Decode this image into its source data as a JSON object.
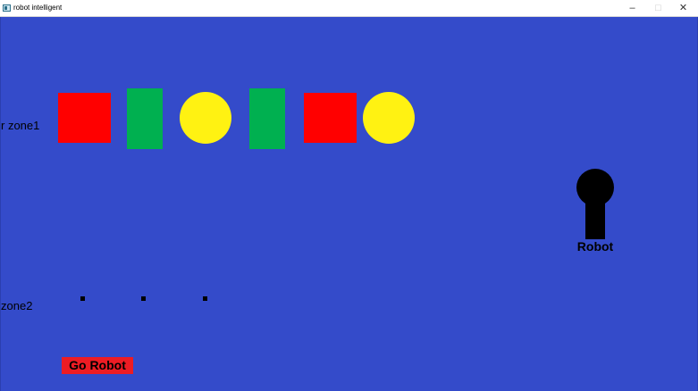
{
  "window": {
    "title": "robot intelligent",
    "minimize": "–",
    "maximize": "□",
    "close": "✕"
  },
  "scene": {
    "background_color": "#344bca",
    "zone1_label": "r zone1",
    "zone2_label": "zone2",
    "zone1_shapes": [
      {
        "shape": "square",
        "color": "#ff0000"
      },
      {
        "shape": "rectangle",
        "color": "#00b050"
      },
      {
        "shape": "circle",
        "color": "#fff212"
      },
      {
        "shape": "rectangle",
        "color": "#00b050"
      },
      {
        "shape": "square",
        "color": "#ff0000"
      },
      {
        "shape": "circle",
        "color": "#fff212"
      }
    ],
    "zone2_slots": 3,
    "robot_label": "Robot",
    "go_button_label": "Go Robot",
    "go_button_color": "#ed1c24"
  }
}
